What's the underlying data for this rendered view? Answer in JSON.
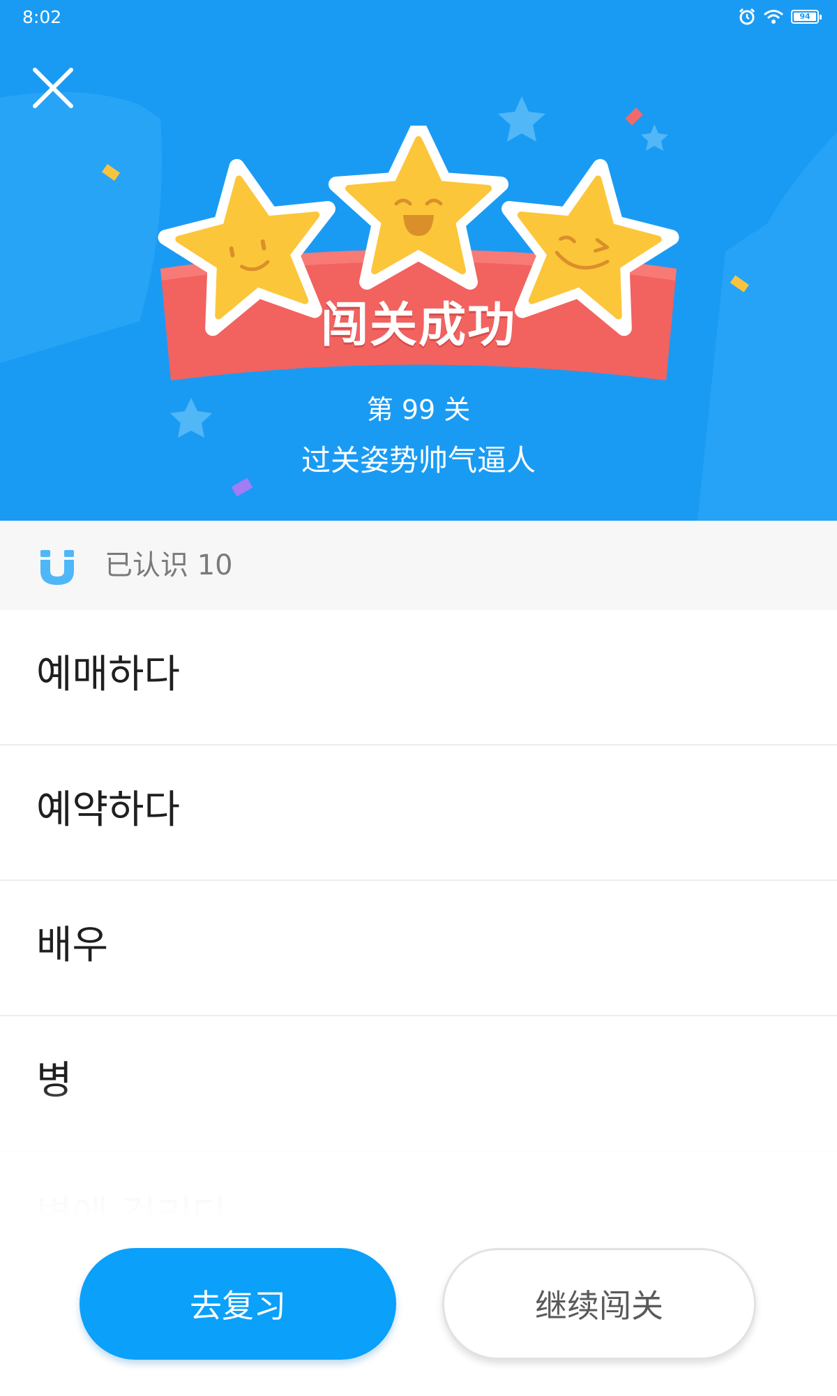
{
  "status_bar": {
    "time": "8:02",
    "battery": "94",
    "icons": [
      "alarm-icon",
      "wifi-icon",
      "battery-icon"
    ]
  },
  "header": {
    "close_icon": "close-icon",
    "banner": "闯关成功",
    "level": "第 99 关",
    "slogan": "过关姿势帅气逼人",
    "background_color": "#1a9bf3",
    "ribbon_color": "#f2625f",
    "star_color": "#fcc63a"
  },
  "summary": {
    "icon": "magnet-icon",
    "text": "已认识 10"
  },
  "words": [
    {
      "text": "예매하다"
    },
    {
      "text": "예약하다"
    },
    {
      "text": "배우"
    },
    {
      "text": "병"
    },
    {
      "text": "병에 걸리다"
    }
  ],
  "actions": {
    "review_label": "去复习",
    "continue_label": "继续闯关",
    "primary_color": "#0ba0fa"
  }
}
